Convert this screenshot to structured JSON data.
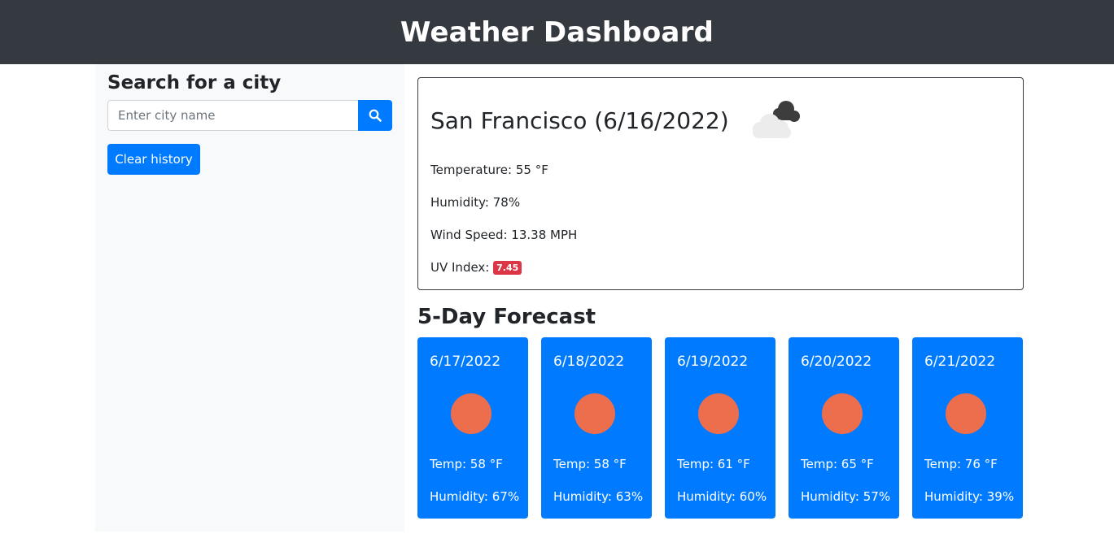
{
  "header": {
    "title": "Weather Dashboard"
  },
  "sidebar": {
    "heading": "Search for a city",
    "search": {
      "placeholder": "Enter city name",
      "value": "",
      "button_icon": "search-icon"
    },
    "clear_label": "Clear history"
  },
  "current": {
    "title": "San Francisco (6/16/2022)",
    "icon": "cloudy-night-icon",
    "temperature": "Temperature: 55 °F",
    "humidity": "Humidity: 78%",
    "wind": "Wind Speed: 13.38 MPH",
    "uv_label": "UV Index:",
    "uv_value": "7.45",
    "uv_color": "#dc3545"
  },
  "forecast": {
    "title": "5-Day Forecast",
    "days": [
      {
        "date": "6/17/2022",
        "icon": "sun-icon",
        "temp": "Temp: 58 °F",
        "humidity": "Humidity: 67%"
      },
      {
        "date": "6/18/2022",
        "icon": "sun-icon",
        "temp": "Temp: 58 °F",
        "humidity": "Humidity: 63%"
      },
      {
        "date": "6/19/2022",
        "icon": "sun-icon",
        "temp": "Temp: 61 °F",
        "humidity": "Humidity: 60%"
      },
      {
        "date": "6/20/2022",
        "icon": "sun-icon",
        "temp": "Temp: 65 °F",
        "humidity": "Humidity: 57%"
      },
      {
        "date": "6/21/2022",
        "icon": "sun-icon",
        "temp": "Temp: 76 °F",
        "humidity": "Humidity: 39%"
      }
    ]
  },
  "colors": {
    "header_bg": "#343a40",
    "accent": "#007bff",
    "sun": "#ec6e4c",
    "sidebar_bg": "#f8f9fa"
  }
}
